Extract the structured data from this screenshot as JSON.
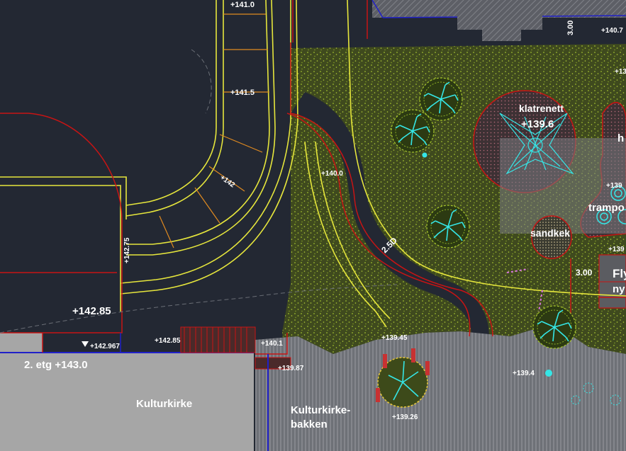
{
  "drawing": {
    "title": "CAD site plan",
    "colors": {
      "background": "#232833",
      "curb_yellow": "#e6e63c",
      "boundary_red": "#c81414",
      "grass": "#3f4a1e",
      "grass_dots": "#9ebc2e",
      "paving": "#7f8187",
      "building": "#a6a6a6",
      "tree": "#35e6e6"
    },
    "elevations": {
      "e141_0": "+141.0",
      "e141_5": "+141.5",
      "e142": "+142",
      "e142_75": "+142.75",
      "e142_85_big": "+142.85",
      "e142_96": "+142.967",
      "e142_85_small": "+142.85",
      "e140_1": "+140.1",
      "e139_87": "+139.87",
      "e140_0": "+140.0",
      "e139_45": "+139.45",
      "e139_26": "+139.26",
      "e139_4": "+139.4",
      "e140_7": "+140.7",
      "e139_right": "+139",
      "e139_right2": "+139",
      "e139_top": "+13",
      "e139_6": "+139.6"
    },
    "dimensions": {
      "d300_top": "3.00",
      "d300_right": "3.00",
      "slope": "2.5D"
    },
    "labels": {
      "floor": "2. etg +143.0",
      "building": "Kulturkirke",
      "plaza_line1": "Kulturkirke-",
      "plaza_line2": "bakken",
      "climbing": "klatrenett",
      "sandbox": "sandkek",
      "trampoline": "trampo",
      "hut": "h",
      "fly": "Fly",
      "ny": "ny"
    },
    "icons": [
      "triangle-marker-icon",
      "tree-symbol-icon",
      "climbing-net-icon",
      "trampoline-icon",
      "drain-icon"
    ]
  }
}
